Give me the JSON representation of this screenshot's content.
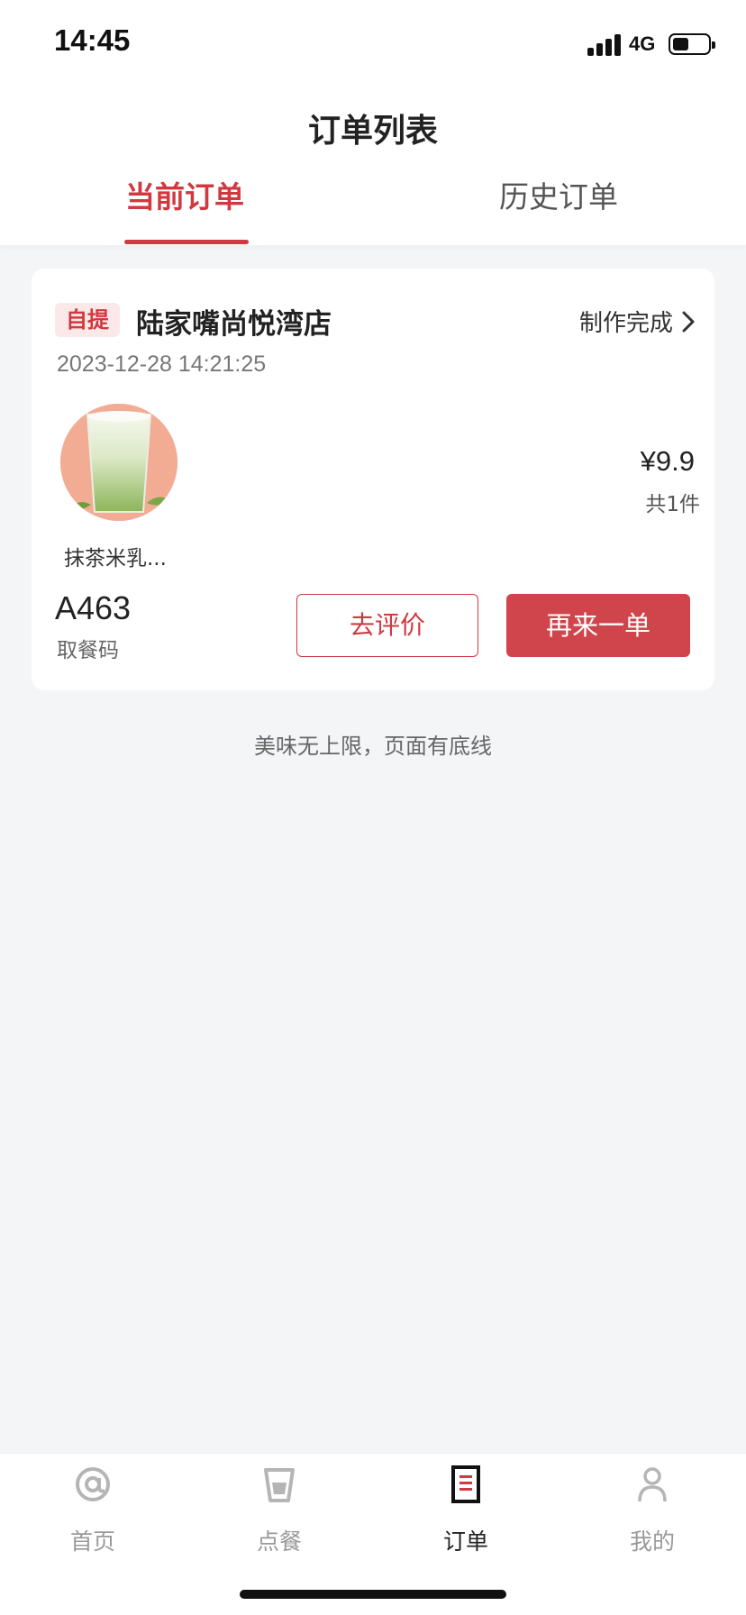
{
  "status_bar": {
    "time": "14:45",
    "network": "4G",
    "battery_level": 0.45
  },
  "header": {
    "title": "订单列表",
    "tabs": [
      {
        "label": "当前订单",
        "active": true
      },
      {
        "label": "历史订单",
        "active": false
      }
    ]
  },
  "order": {
    "badge": "自提",
    "store": "陆家嘴尚悦湾店",
    "status": "制作完成",
    "time": "2023-12-28 14:21:25",
    "product": {
      "name": "抹茶米乳...",
      "image_icon": "matcha-drink-image"
    },
    "price": "¥9.9",
    "count": "共1件",
    "pickup_code": "A463",
    "pickup_code_label": "取餐码",
    "review_button": "去评价",
    "reorder_button": "再来一单"
  },
  "footer_note": "美味无上限，页面有底线",
  "bottom_nav": [
    {
      "label": "首页",
      "icon": "at-icon",
      "active": false
    },
    {
      "label": "点餐",
      "icon": "cup-icon",
      "active": false
    },
    {
      "label": "订单",
      "icon": "order-icon",
      "active": true
    },
    {
      "label": "我的",
      "icon": "user-icon",
      "active": false
    }
  ],
  "colors": {
    "accent": "#d0393f",
    "background": "#f4f5f7"
  }
}
